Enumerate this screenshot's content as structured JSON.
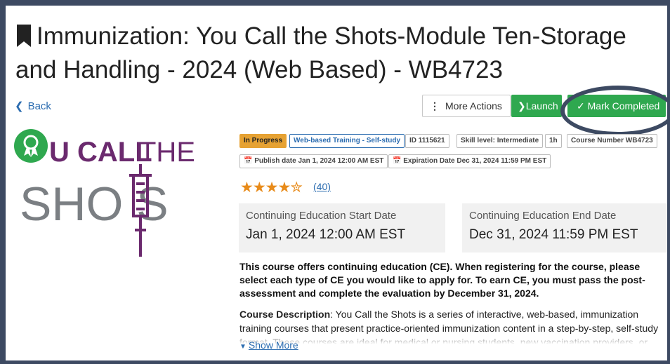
{
  "page": {
    "title": "Immunization: You Call the Shots-Module Ten-Storage and Handling - 2024 (Web Based) - WB4723",
    "back_label": "Back"
  },
  "actions": {
    "more_actions_label": "More Actions",
    "launch_label": "Launch",
    "mark_completed_label": "Mark Completed"
  },
  "logo": {
    "text_line1_prefix": "U CALL",
    "text_line1_suffix": "THE",
    "text_line2": "SHO  S",
    "brand_color": "#6b2a6e",
    "gray_color": "#7b7f83"
  },
  "badges": {
    "status": "In Progress",
    "type": "Web-based Training - Self-study",
    "id": "ID 1115621",
    "skill": "Skill level: Intermediate",
    "duration": "1h",
    "course_number": "Course Number WB4723",
    "publish_date": "Publish date Jan 1, 2024 12:00 AM EST",
    "expiration_date": "Expiration Date Dec 31, 2024 11:59 PM EST"
  },
  "rating": {
    "value": 4.5,
    "max": 5,
    "count_label": "(40)"
  },
  "ce": {
    "start_label": "Continuing Education Start Date",
    "start_value": "Jan 1, 2024 12:00 AM EST",
    "end_label": "Continuing Education End Date",
    "end_value": "Dec 31, 2024 11:59 PM EST",
    "note": "This course offers continuing education (CE). When registering for the course, please select each type of CE you would like to apply for. To earn CE, you must pass the post-assessment and complete the evaluation by December 31, 2024."
  },
  "description": {
    "label": "Course Description",
    "text": ": You Call the Shots is a series of interactive, web-based, immunization training courses that present practice-oriented immunization content in a step-by-step, self-study format. These courses are ideal for medical or nursing students, new vaccination providers, or seasoned",
    "show_more_label": "Show More"
  },
  "colors": {
    "frame": "#3d4a62",
    "accent_green": "#2fa84f",
    "link_blue": "#2b6cb0",
    "star_orange": "#e88b1a",
    "progress_orange": "#e6a233"
  }
}
